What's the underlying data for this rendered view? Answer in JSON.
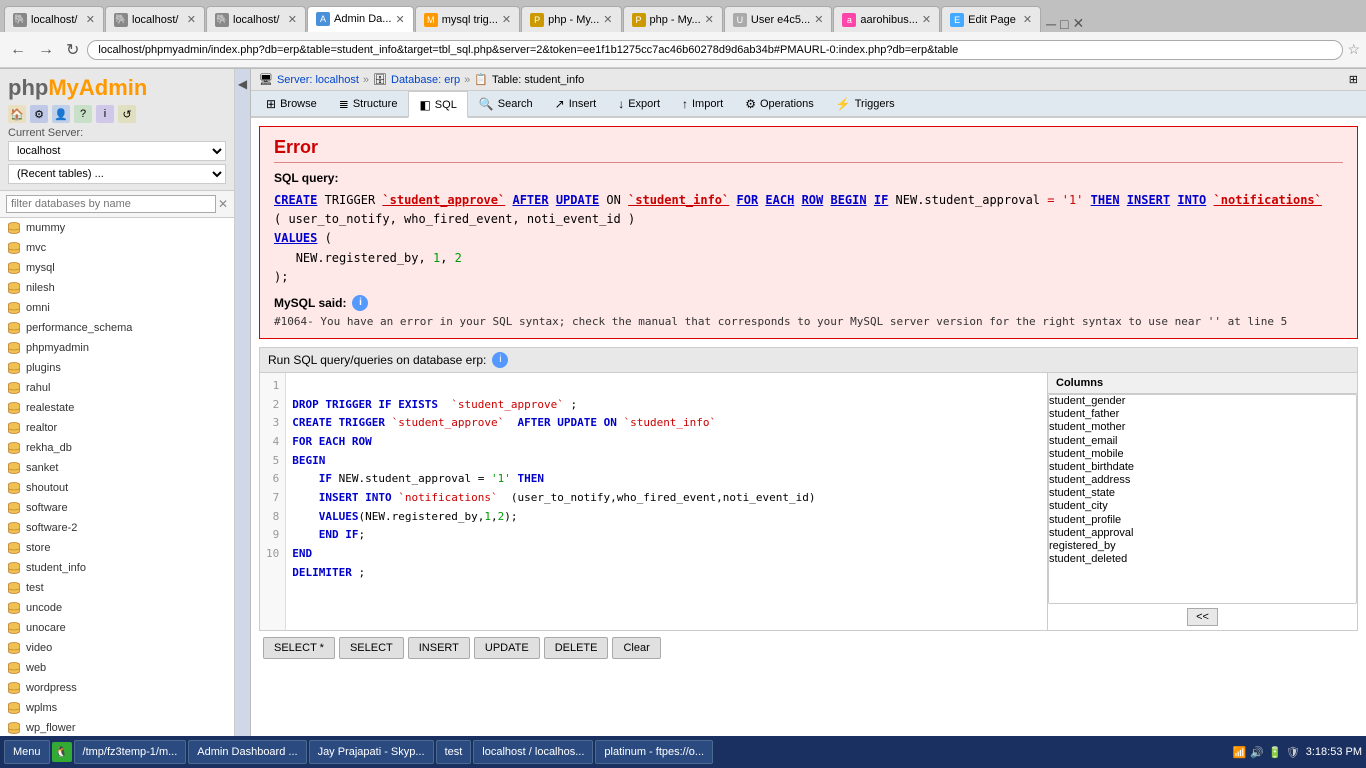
{
  "browser": {
    "tabs": [
      {
        "id": "t1",
        "favicon": "🐘",
        "title": "localhost/",
        "active": false
      },
      {
        "id": "t2",
        "favicon": "🐘",
        "title": "localhost/",
        "active": false
      },
      {
        "id": "t3",
        "favicon": "🐘",
        "title": "localhost/",
        "active": false
      },
      {
        "id": "t4",
        "favicon": "A",
        "title": "Admin Da...",
        "active": true
      },
      {
        "id": "t5",
        "favicon": "M",
        "title": "mysql trig...",
        "active": false
      },
      {
        "id": "t6",
        "favicon": "P",
        "title": "php - My...",
        "active": false
      },
      {
        "id": "t7",
        "favicon": "P",
        "title": "php - My...",
        "active": false
      },
      {
        "id": "t8",
        "favicon": "U",
        "title": "User e4c5...",
        "active": false
      },
      {
        "id": "t9",
        "favicon": "a",
        "title": "aarohibus...",
        "active": false
      },
      {
        "id": "t10",
        "favicon": "E",
        "title": "Edit Page",
        "active": false
      }
    ],
    "url": "localhost/phpmyadmin/index.php?db=erp&table=student_info&target=tbl_sql.php&server=2&token=ee1f1b1275cc7ac46b60278d9d6ab34b#PMAURL-0:index.php?db=erp&table"
  },
  "sidebar": {
    "logo": "phpMyAdmin",
    "server_label": "Current Server:",
    "server_value": "localhost",
    "recent_label": "(Recent tables) ...",
    "filter_placeholder": "filter databases by name",
    "databases": [
      "mummy",
      "mvc",
      "mysql",
      "nilesh",
      "omni",
      "performance_schema",
      "phpmyadmin",
      "plugins",
      "rahul",
      "realestate",
      "realtor",
      "rekha_db",
      "sanket",
      "shoutout",
      "software",
      "software-2",
      "store",
      "student_info",
      "test",
      "uncode",
      "unocare",
      "video",
      "web",
      "wordpress",
      "wplms",
      "wp_flower"
    ]
  },
  "breadcrumb": {
    "server": "Server: localhost",
    "db": "Database: erp",
    "table": "Table: student_info"
  },
  "tabs": [
    {
      "label": "Browse",
      "icon": "⊞"
    },
    {
      "label": "Structure",
      "icon": "≣"
    },
    {
      "label": "SQL",
      "icon": "◧"
    },
    {
      "label": "Search",
      "icon": "🔍"
    },
    {
      "label": "Insert",
      "icon": "↗"
    },
    {
      "label": "Export",
      "icon": "↓"
    },
    {
      "label": "Import",
      "icon": "↑"
    },
    {
      "label": "Operations",
      "icon": "⚙"
    },
    {
      "label": "Triggers",
      "icon": "⚡"
    }
  ],
  "error": {
    "title": "Error",
    "sql_label": "SQL query:",
    "sql_create": "CREATE TRIGGER `student_approve` AFTER UPDATE ON `student_info` FOR EACH ROW BEGIN IF NEW.student_approval = '1' THEN INSERT INTO `notifications`",
    "sql_values": "( user_to_notify, who_fired_event, noti_event_id )",
    "sql_values2": "VALUES (",
    "sql_new": "NEW.registered_by, 1, 2",
    "sql_end": ");",
    "mysql_said": "MySQL said:",
    "error_number": "#1064",
    "error_text": "- You have an error in your SQL syntax; check the manual that corresponds to your MySQL server version for the right syntax to use near '' at line 5"
  },
  "sql_editor": {
    "run_label": "Run SQL query/queries on database erp:",
    "lines": [
      "DROP TRIGGER IF EXISTS  `student_approve` ;",
      "CREATE TRIGGER `student_approve`  AFTER UPDATE ON `student_info`",
      "FOR EACH ROW",
      "BEGIN",
      "    IF NEW.student_approval = '1' THEN",
      "    INSERT INTO `notifications`  (user_to_notify,who_fired_event,noti_event_id)",
      "    VALUES(NEW.registered_by,1,2);",
      "    END IF;",
      "END",
      "DELIMITER ;"
    ],
    "buttons": [
      "SELECT *",
      "SELECT",
      "INSERT",
      "UPDATE",
      "DELETE",
      "Clear"
    ]
  },
  "columns": {
    "title": "Columns",
    "items": [
      "student_gender",
      "student_father",
      "student_mother",
      "student_email",
      "student_mobile",
      "student_birthdate",
      "student_address",
      "student_state",
      "student_city",
      "student_profile",
      "student_approval",
      "registered_by",
      "student_deleted"
    ],
    "nav_btn": "<<"
  },
  "taskbar": {
    "menu": "Menu",
    "items": [
      "/tmp/fz3temp-1/m...",
      "Admin Dashboard ...",
      "Jay Prajapati - Skyp...",
      "test",
      "localhost / localhos...",
      "platinum - ftpes://o..."
    ],
    "time": "3:18:53 PM"
  }
}
